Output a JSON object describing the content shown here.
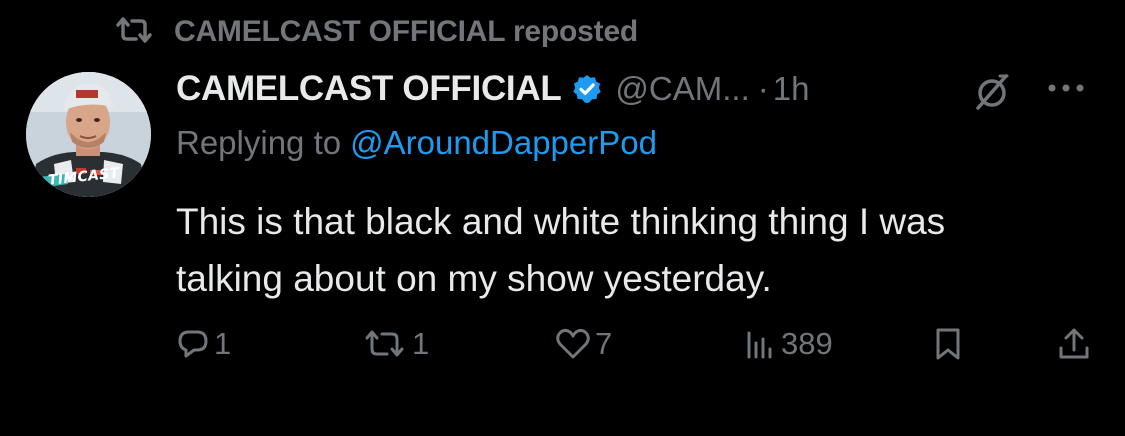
{
  "repost": {
    "icon": "repost-icon",
    "text": "CAMELCAST OFFICIAL reposted"
  },
  "author": {
    "avatar_label": "TIMCAST",
    "display_name": "CAMELCAST OFFICIAL",
    "verified_icon": "verified-badge-icon",
    "handle": "@CAM...",
    "separator": "·",
    "time": "1h"
  },
  "header_icons": [
    "grok-icon",
    "more-icon"
  ],
  "reply": {
    "prefix": "Replying to",
    "mention": "@AroundDapperPod"
  },
  "body": {
    "line1": "This is that black and white thinking thing I was",
    "line2": "talking about on my show yesterday."
  },
  "actions": {
    "reply_count": "1",
    "repost_count": "1",
    "like_count": "7",
    "view_count": "389",
    "icons": [
      "reply-icon",
      "repost-icon",
      "like-icon",
      "views-icon",
      "bookmark-icon",
      "share-icon"
    ]
  },
  "colors": {
    "background": "#000000",
    "text": "#e7e9ea",
    "muted": "#71767b",
    "link": "#1d9bf0",
    "verified": "#1d9bf0"
  }
}
